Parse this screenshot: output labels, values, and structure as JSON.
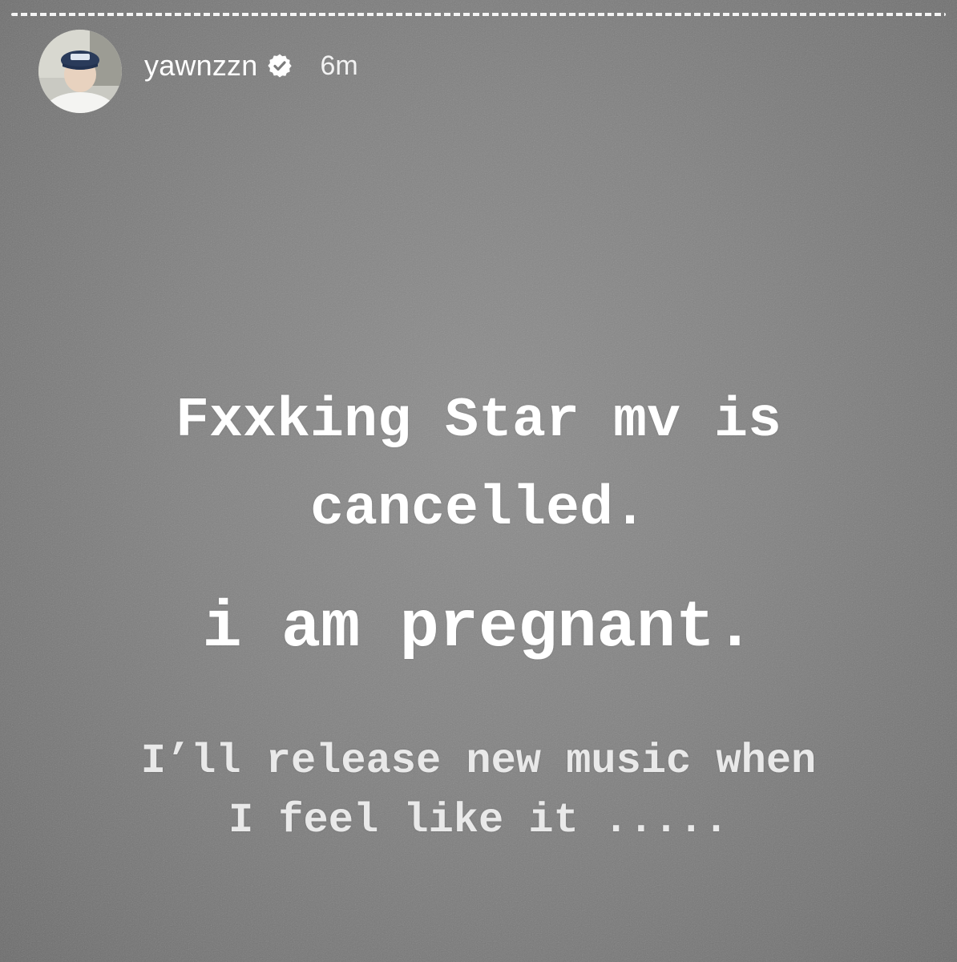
{
  "story": {
    "progress": 1.0,
    "user": {
      "username": "yawnzzn",
      "verified": true,
      "time_ago": "6m"
    },
    "text": {
      "line1": "Fxxking Star mv is",
      "line2": "cancelled.",
      "line3": "i am pregnant.",
      "line4": "I’ll release new music when",
      "line5": "I feel like it ....."
    }
  },
  "colors": {
    "background": "#808080",
    "text": "#ffffff"
  }
}
